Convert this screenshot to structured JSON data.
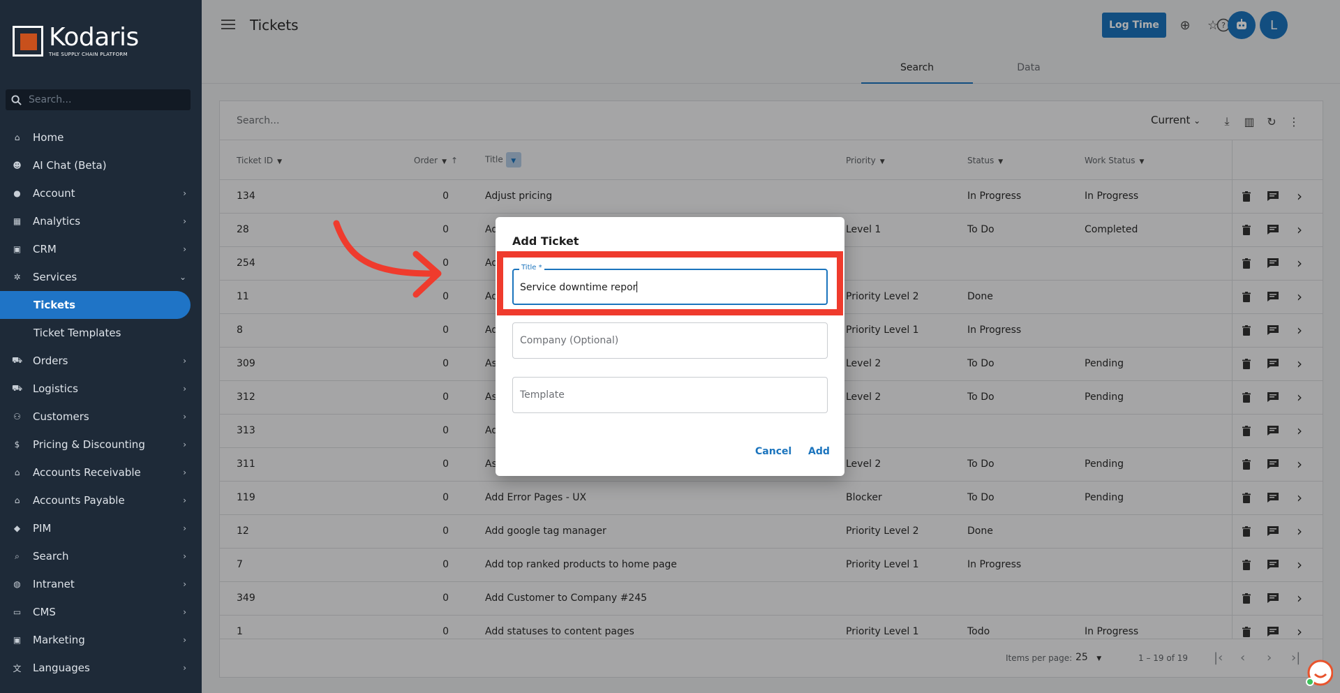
{
  "brand": {
    "name": "Kodaris",
    "tagline": "THE SUPPLY CHAIN PLATFORM"
  },
  "sidebar": {
    "search_placeholder": "Search...",
    "items": [
      {
        "label": "Home",
        "icon": "home-icon",
        "chevron": false
      },
      {
        "label": "AI Chat (Beta)",
        "icon": "robot-icon",
        "chevron": false
      },
      {
        "label": "Account",
        "icon": "user-icon",
        "chevron": true
      },
      {
        "label": "Analytics",
        "icon": "analytics-icon",
        "chevron": true
      },
      {
        "label": "CRM",
        "icon": "crm-icon",
        "chevron": true
      },
      {
        "label": "Services",
        "icon": "gears-icon",
        "chevron": true,
        "expanded": true
      },
      {
        "label": "Tickets",
        "sub": true,
        "active": true
      },
      {
        "label": "Ticket Templates",
        "sub": true
      },
      {
        "label": "Orders",
        "icon": "truck-icon",
        "chevron": true
      },
      {
        "label": "Logistics",
        "icon": "logistics-icon",
        "chevron": true
      },
      {
        "label": "Customers",
        "icon": "customers-icon",
        "chevron": true
      },
      {
        "label": "Pricing & Discounting",
        "icon": "dollar-icon",
        "chevron": true
      },
      {
        "label": "Accounts Receivable",
        "icon": "bank-icon",
        "chevron": true
      },
      {
        "label": "Accounts Payable",
        "icon": "bank-icon",
        "chevron": true
      },
      {
        "label": "PIM",
        "icon": "tag-icon",
        "chevron": true
      },
      {
        "label": "Search",
        "icon": "search-icon",
        "chevron": true
      },
      {
        "label": "Intranet",
        "icon": "globe-icon",
        "chevron": true
      },
      {
        "label": "CMS",
        "icon": "cms-icon",
        "chevron": true
      },
      {
        "label": "Marketing",
        "icon": "marketing-icon",
        "chevron": true
      },
      {
        "label": "Languages",
        "icon": "translate-icon",
        "chevron": true
      }
    ]
  },
  "header": {
    "title": "Tickets",
    "log_time_label": "Log Time",
    "avatar_initial": "L"
  },
  "tabs": [
    {
      "label": "Search",
      "active": true
    },
    {
      "label": "Data",
      "active": false
    }
  ],
  "table": {
    "search_placeholder": "Search...",
    "view_label": "Current",
    "columns": [
      "Ticket ID",
      "Order",
      "Title",
      "Priority",
      "Status",
      "Work Status"
    ],
    "rows": [
      {
        "id": "134",
        "order": "0",
        "title": "Adjust pricing",
        "priority": "",
        "status": "In Progress",
        "work_status": "In Progress"
      },
      {
        "id": "28",
        "order": "0",
        "title": "Ad",
        "priority": "Level 1",
        "status": "To Do",
        "work_status": "Completed"
      },
      {
        "id": "254",
        "order": "0",
        "title": "Ad",
        "priority": "",
        "status": "",
        "work_status": ""
      },
      {
        "id": "11",
        "order": "0",
        "title": "Ad",
        "priority": "Priority Level 2",
        "status": "Done",
        "work_status": ""
      },
      {
        "id": "8",
        "order": "0",
        "title": "Ad",
        "priority": "Priority Level 1",
        "status": "In Progress",
        "work_status": ""
      },
      {
        "id": "309",
        "order": "0",
        "title": "As",
        "priority": "Level 2",
        "status": "To Do",
        "work_status": "Pending"
      },
      {
        "id": "312",
        "order": "0",
        "title": "As",
        "priority": "Level 2",
        "status": "To Do",
        "work_status": "Pending"
      },
      {
        "id": "313",
        "order": "0",
        "title": "Ad",
        "priority": "",
        "status": "",
        "work_status": ""
      },
      {
        "id": "311",
        "order": "0",
        "title": "As",
        "priority": "Level 2",
        "status": "To Do",
        "work_status": "Pending"
      },
      {
        "id": "119",
        "order": "0",
        "title": "Add Error Pages - UX",
        "priority": "Blocker",
        "status": "To Do",
        "work_status": "Pending"
      },
      {
        "id": "12",
        "order": "0",
        "title": "Add google tag manager",
        "priority": "Priority Level 2",
        "status": "Done",
        "work_status": ""
      },
      {
        "id": "7",
        "order": "0",
        "title": "Add top ranked products to home page",
        "priority": "Priority Level 1",
        "status": "In Progress",
        "work_status": ""
      },
      {
        "id": "349",
        "order": "0",
        "title": "Add Customer to Company #245",
        "priority": "",
        "status": "",
        "work_status": ""
      },
      {
        "id": "1",
        "order": "0",
        "title": "Add statuses to content pages",
        "priority": "Priority Level 1",
        "status": "Todo",
        "work_status": "In Progress"
      }
    ],
    "paginator": {
      "items_per_page_label": "Items per page:",
      "page_size": "25",
      "range_label": "1 – 19 of 19"
    }
  },
  "dialog": {
    "title": "Add Ticket",
    "title_field_label": "Title *",
    "title_field_value": "Service downtime repor",
    "company_placeholder": "Company (Optional)",
    "template_placeholder": "Template",
    "cancel_label": "Cancel",
    "add_label": "Add"
  },
  "colors": {
    "accent": "#1b74bd",
    "sidebar": "#1e2a38",
    "annotation": "#ef3b2d",
    "logo_square": "#c8501c"
  }
}
